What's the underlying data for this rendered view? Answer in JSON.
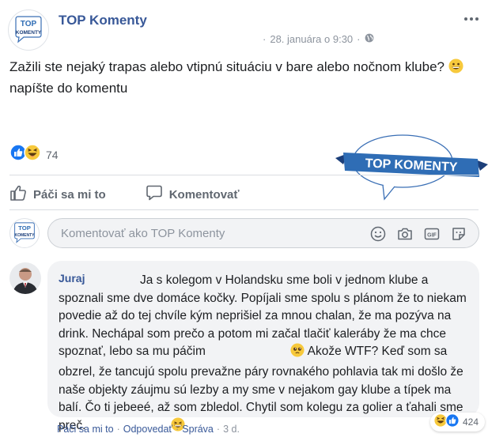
{
  "post": {
    "page_name": "TOP Komenty",
    "timestamp": "28. januára o 9:30",
    "separator": "·",
    "text_line1": "Zažili ste nejaký trapas alebo vtipnú situáciu v bare alebo nočnom klube?",
    "text_line2": "napíšte do komentu",
    "reaction_count": "74"
  },
  "logo": {
    "line1": "TOP",
    "line2": "KOMENTY"
  },
  "actions": {
    "like_label": "Páči sa mi to",
    "comment_label": "Komentovať"
  },
  "brand_bubble": {
    "text": "TOP KOMENTY"
  },
  "composer": {
    "placeholder": "Komentovať ako TOP Komenty",
    "gif_label": "GIF"
  },
  "comment": {
    "author": "Juraj",
    "text_part1": "Ja s kolegom v Holandsku sme boli v jednom klube a spoznali sme dve domáce kočky. Popíjali sme spolu s plánom že to niekam povedie až do tej chvíle kým neprišiel za mnou chalan, že ma pozýva na drink. Nechápal som prečo a potom mi začal tlačiť kaleráby že ma chce spoznať, lebo sa mu páčim",
    "text_part2": "Akože WTF? Keď som sa obzrel, že tancujú spolu prevažne páry rovnakého pohlavia tak mi došlo že naše objekty záujmu sú lezby a my sme v nejakom gay klube a típek ma balí. Čo ti jebeeé, až som zbledol. Chytil som kolegu za golier a ťahali sme preč.",
    "reaction_count": "424",
    "like_link": "Páči sa mi to",
    "reply_link": "Odpovedať",
    "message_link": "Správa",
    "age": "3 d.",
    "dot": "·"
  },
  "colors": {
    "link_blue": "#385898",
    "like_blue": "#1877f2",
    "haha_yellow": "#f7c93c",
    "brand_blue": "#2f6db5",
    "muted": "#606770"
  }
}
